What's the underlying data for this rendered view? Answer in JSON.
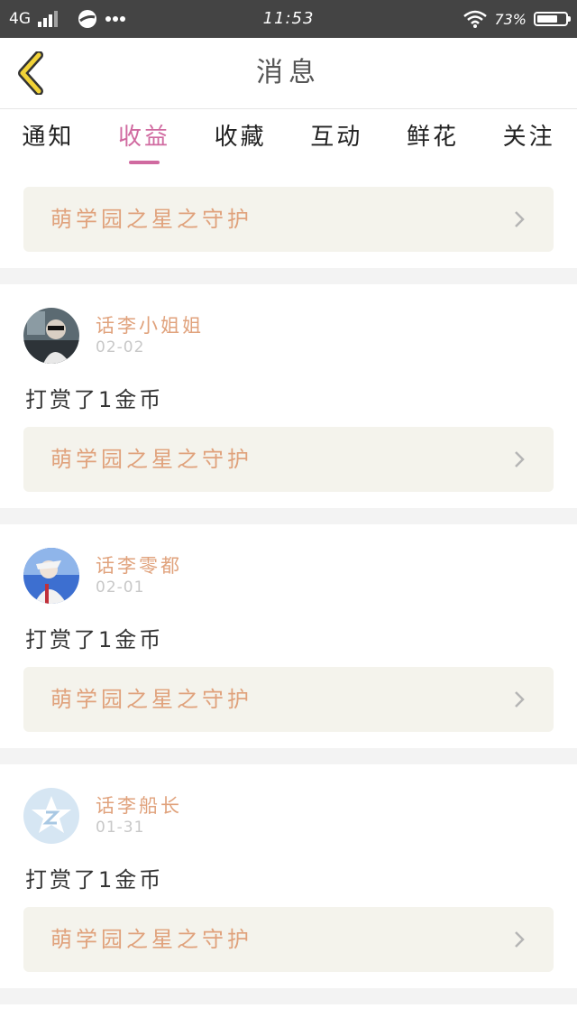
{
  "status_bar": {
    "network": "4G",
    "time": "11:53",
    "battery": "73%",
    "battery_level": 0.73
  },
  "header": {
    "title": "消息"
  },
  "tabs": [
    {
      "label": "通知"
    },
    {
      "label": "收益"
    },
    {
      "label": "收藏"
    },
    {
      "label": "互动"
    },
    {
      "label": "鲜花"
    },
    {
      "label": "关注"
    }
  ],
  "active_tab": "收益",
  "top_item": {
    "gift": "萌学园之星之守护"
  },
  "items": [
    {
      "name": "话李小姐姐",
      "date": "02-02",
      "message": "打赏了1金币",
      "gift": "萌学园之星之守护",
      "avatar": "avatar-photo-man"
    },
    {
      "name": "话李零都",
      "date": "02-01",
      "message": "打赏了1金币",
      "gift": "萌学园之星之守护",
      "avatar": "avatar-photo-boy"
    },
    {
      "name": "话李船长",
      "date": "01-31",
      "message": "打赏了1金币",
      "gift": "萌学园之星之守护",
      "avatar": "avatar-default-star"
    }
  ],
  "colors": {
    "accent": "#d06aa0",
    "gift_text": "#e0a27c",
    "back_arrow": "#f2d338"
  }
}
